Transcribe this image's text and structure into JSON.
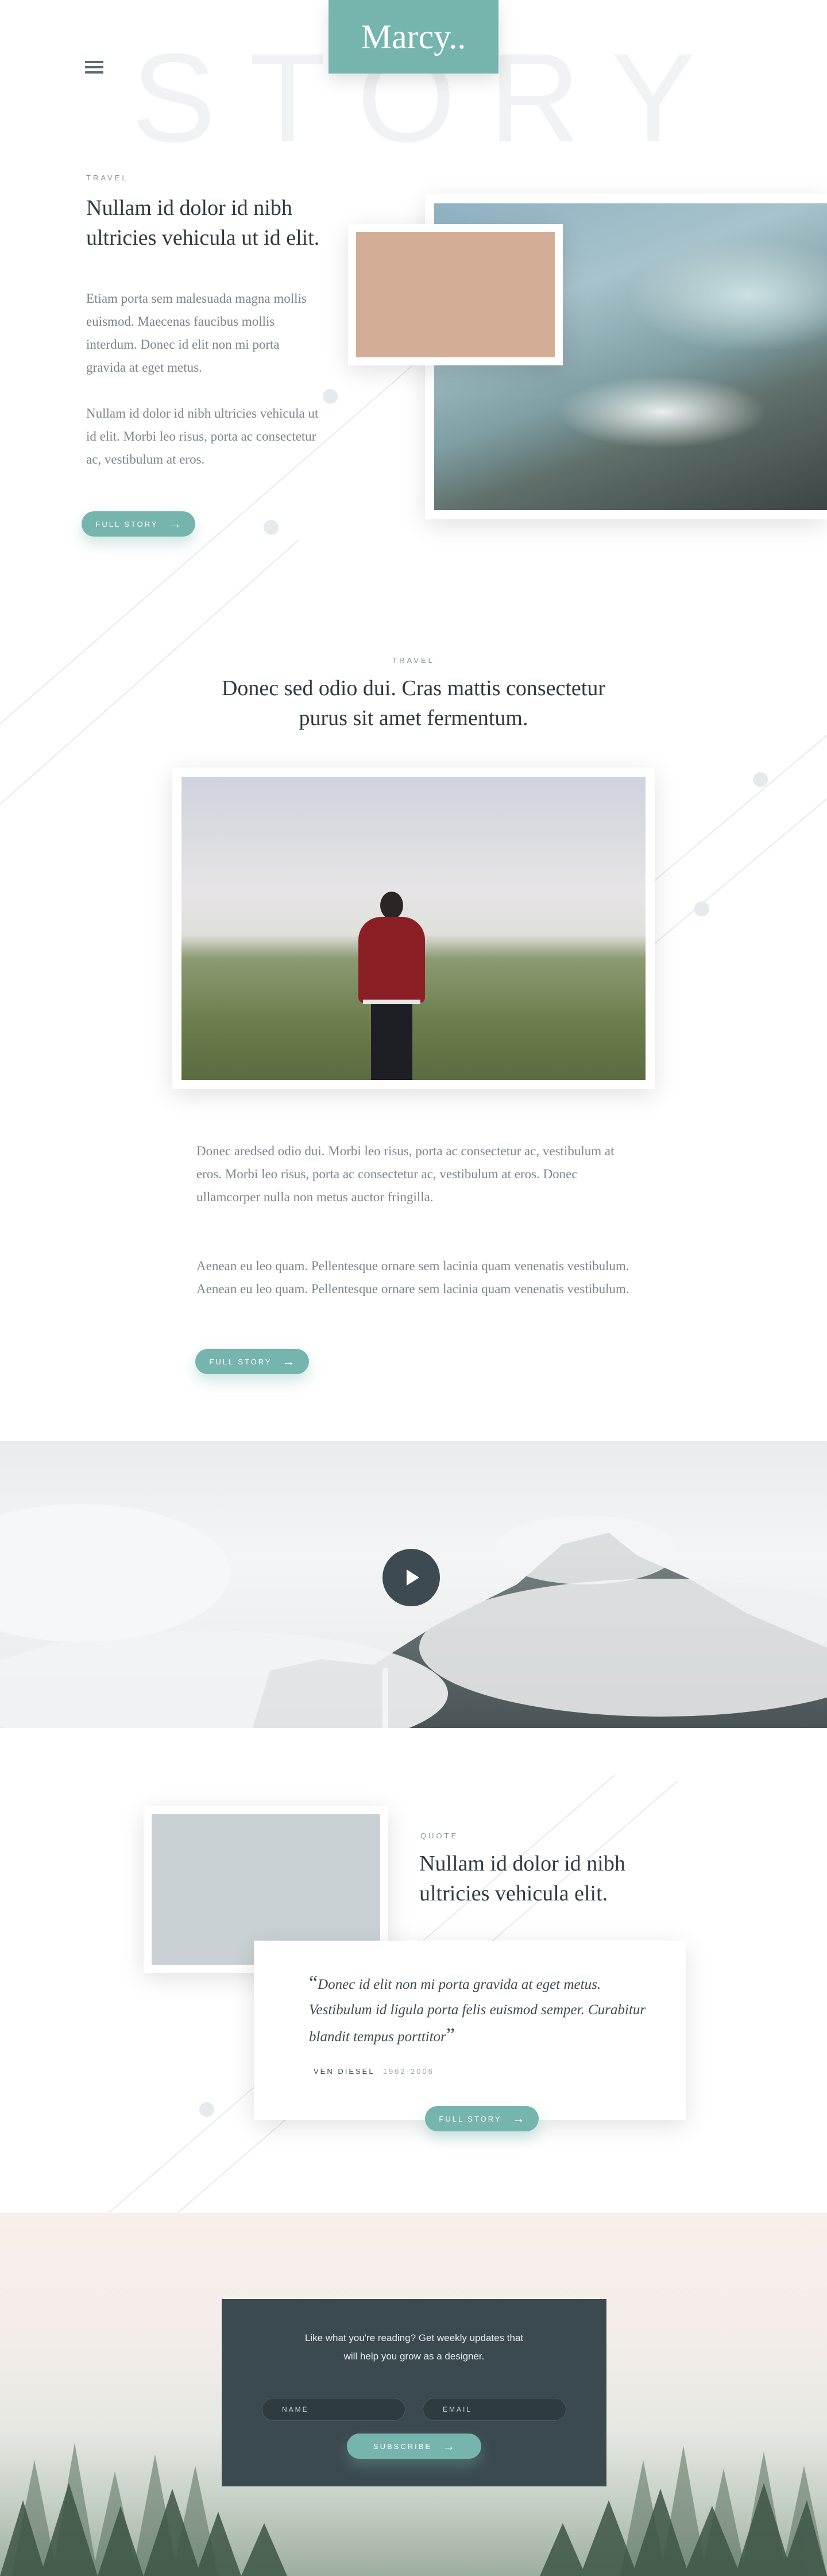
{
  "header": {
    "logo": "Marcy..",
    "bg_word": "STORY",
    "menu_icon": "hamburger-menu-icon"
  },
  "post1": {
    "eyebrow": "TRAVEL",
    "title": "Nullam id dolor id nibh ultricies vehicula ut id elit.",
    "para1": "Etiam porta sem malesuada magna mollis euismod. Maecenas faucibus mollis interdum. Donec id elit non mi porta gravida at eget metus.",
    "para2": "Nullam id dolor id nibh ultricies vehicula ut id elit. Morbi leo risus, porta ac consectetur ac, vestibulum at eros.",
    "button": "FULL STORY"
  },
  "post2": {
    "eyebrow": "TRAVEL",
    "title": "Donec sed odio dui. Cras mattis consectetur purus sit amet fermentum.",
    "para1": "Donec aredsed odio dui. Morbi leo risus, porta ac consectetur ac, vestibulum at eros. Morbi leo risus, porta ac consectetur ac, vestibulum at eros. Donec ullamcorper nulla non metus auctor fringilla.",
    "para2": "Aenean eu leo quam. Pellentesque ornare sem lacinia quam venenatis vestibulum. Aenean eu leo quam. Pellentesque ornare sem lacinia quam venenatis vestibulum.",
    "button": "FULL STORY"
  },
  "video": {
    "play_icon": "play-icon"
  },
  "quote_post": {
    "eyebrow": "QUOTE",
    "title": "Nullam id dolor id nibh ultricies vehicula elit.",
    "quote": "Donec id elit non mi porta gravida at eget metus. Vestibulum id ligula porta felis euismod semper. Curabitur blandit tempus porttitor",
    "author": "VEN DIESEL",
    "years": "1962-2006",
    "button": "FULL STORY"
  },
  "subscribe": {
    "message_line1": "Like what you're reading? Get weekly updates that",
    "message_line2": "will help you grow as a designer.",
    "name_placeholder": "NAME",
    "email_placeholder": "EMAIL",
    "button": "SUBSCRIBE"
  },
  "colors": {
    "accent": "#76b5ad",
    "dark": "#3b4a4f",
    "text": "#2f3b40",
    "muted": "#7a868b",
    "swatch_peach": "#d4ad96",
    "swatch_gray": "#c9d1d5"
  }
}
